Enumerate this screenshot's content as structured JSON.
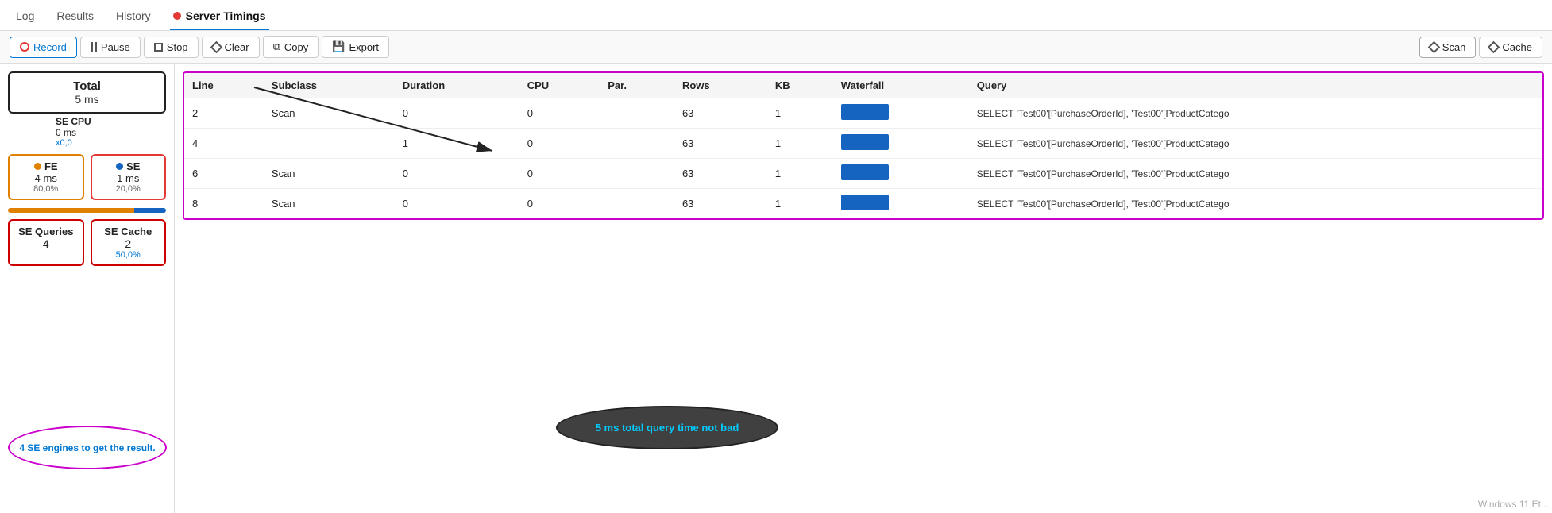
{
  "nav": {
    "tabs": [
      {
        "id": "log",
        "label": "Log",
        "active": false
      },
      {
        "id": "results",
        "label": "Results",
        "active": false
      },
      {
        "id": "history",
        "label": "History",
        "active": false
      },
      {
        "id": "server-timings",
        "label": "Server Timings",
        "active": true
      }
    ]
  },
  "toolbar": {
    "record_label": "Record",
    "pause_label": "Pause",
    "stop_label": "Stop",
    "clear_label": "Clear",
    "copy_label": "Copy",
    "export_label": "Export",
    "scan_label": "Scan",
    "cache_label": "Cache"
  },
  "left_panel": {
    "total_label": "Total",
    "total_value": "5 ms",
    "fe_label": "FE",
    "fe_value": "4 ms",
    "fe_pct": "80,0%",
    "se_label": "SE",
    "se_value": "1 ms",
    "se_pct": "20,0%",
    "se_queries_label": "SE Queries",
    "se_queries_value": "4",
    "se_cache_label": "SE Cache",
    "se_cache_value": "2",
    "se_cache_sub": "50,0%",
    "cpu_label": "SE CPU",
    "cpu_value": "0 ms",
    "cpu_sub": "x0,0"
  },
  "table": {
    "columns": [
      "Line",
      "Subclass",
      "Duration",
      "CPU",
      "Par.",
      "Rows",
      "KB",
      "Waterfall",
      "Query"
    ],
    "rows": [
      {
        "line": "2",
        "subclass": "Scan",
        "duration": "0",
        "cpu": "0",
        "par": "",
        "rows": "63",
        "kb": "1",
        "query": "SELECT 'Test00'[PurchaseOrderId], 'Test00'[ProductCatego"
      },
      {
        "line": "4",
        "subclass": "",
        "duration": "1",
        "cpu": "0",
        "par": "",
        "rows": "63",
        "kb": "1",
        "query": "SELECT 'Test00'[PurchaseOrderId], 'Test00'[ProductCatego"
      },
      {
        "line": "6",
        "subclass": "Scan",
        "duration": "0",
        "cpu": "0",
        "par": "",
        "rows": "63",
        "kb": "1",
        "query": "SELECT 'Test00'[PurchaseOrderId], 'Test00'[ProductCatego"
      },
      {
        "line": "8",
        "subclass": "Scan",
        "duration": "0",
        "cpu": "0",
        "par": "",
        "rows": "63",
        "kb": "1",
        "query": "SELECT 'Test00'[PurchaseOrderId], 'Test00'[ProductCatego"
      }
    ]
  },
  "annotations": {
    "callout1_text": "4 SE engines to get the result.",
    "callout2_text": "5 ms total query time not bad"
  },
  "watermark": "Windows 11 Et..."
}
